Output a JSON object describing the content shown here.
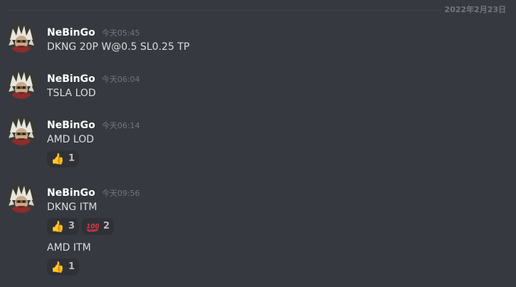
{
  "divider": {
    "date": "2022年2月23日"
  },
  "messages": [
    {
      "username": "NeBinGo",
      "timestamp": "今天05:45",
      "lines": [
        {
          "text": "DKNG 20P W@0.5 SL0.25 TP",
          "reactions": []
        }
      ]
    },
    {
      "username": "NeBinGo",
      "timestamp": "今天06:04",
      "lines": [
        {
          "text": "TSLA LOD",
          "reactions": []
        }
      ]
    },
    {
      "username": "NeBinGo",
      "timestamp": "今天06:14",
      "lines": [
        {
          "text": "AMD LOD",
          "reactions": [
            {
              "icon": "thumbs-up-icon",
              "emoji": "👍",
              "count": "1"
            }
          ]
        }
      ]
    },
    {
      "username": "NeBinGo",
      "timestamp": "今天09:56",
      "lines": [
        {
          "text": "DKNG ITM",
          "reactions": [
            {
              "icon": "thumbs-up-icon",
              "emoji": "👍",
              "count": "3"
            },
            {
              "icon": "hundred-points-icon",
              "emoji": "💯",
              "count": "2"
            }
          ]
        },
        {
          "text": "AMD ITM",
          "reactions": [
            {
              "icon": "thumbs-up-icon",
              "emoji": "👍",
              "count": "1"
            }
          ]
        }
      ]
    }
  ],
  "colors": {
    "background": "#36393f",
    "username": "#ffffff",
    "message_text": "#dcddde",
    "muted": "#72767d",
    "reaction_bg": "#2f3136",
    "hundred_red": "#e2334b"
  }
}
